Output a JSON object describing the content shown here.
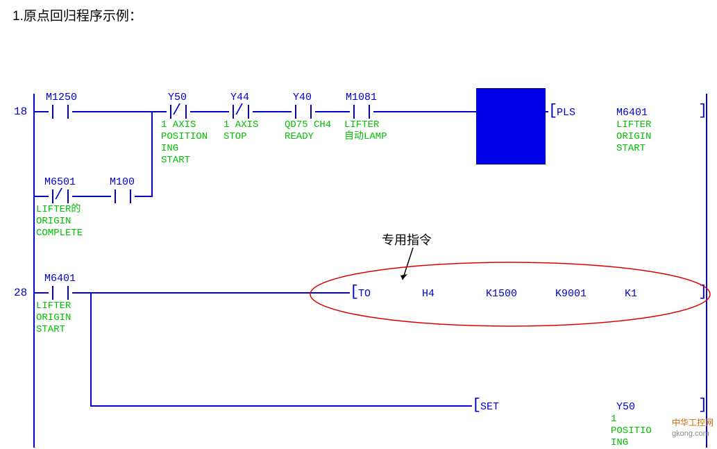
{
  "title": "1.原点回归程序示例：",
  "rung1": {
    "step": "18",
    "contacts": {
      "m1250": {
        "label": "M1250"
      },
      "y50": {
        "label": "Y50",
        "desc": "1 AXIS\nPOSITION\nING\nSTART"
      },
      "y44": {
        "label": "Y44",
        "desc": "1 AXIS\nSTOP"
      },
      "y40": {
        "label": "Y40",
        "desc": "QD75 CH4\nREADY"
      },
      "m1081": {
        "label": "M1081",
        "desc": "LIFTER\n自动LAMP"
      }
    },
    "out": {
      "op": "PLS",
      "dest": "M6401",
      "desc": "LIFTER\nORIGIN\nSTART"
    }
  },
  "rung1_branch": {
    "m6501": {
      "label": "M6501",
      "desc": "LIFTER的\nORIGIN\nCOMPLETE"
    },
    "m100": {
      "label": "M100"
    }
  },
  "rung2": {
    "step": "28",
    "contact": {
      "label": "M6401",
      "desc": "LIFTER\nORIGIN\nSTART"
    },
    "instr": {
      "op": "TO",
      "p1": "H4",
      "p2": "K1500",
      "p3": "K9001",
      "p4": "K1"
    }
  },
  "rung3": {
    "out": {
      "op": "SET",
      "dest": "Y50",
      "desc": "1\nPOSITIO\nING"
    }
  },
  "annotation": "专用指令",
  "watermark": {
    "cn": "中华工控网",
    "en": "gkong.com"
  }
}
